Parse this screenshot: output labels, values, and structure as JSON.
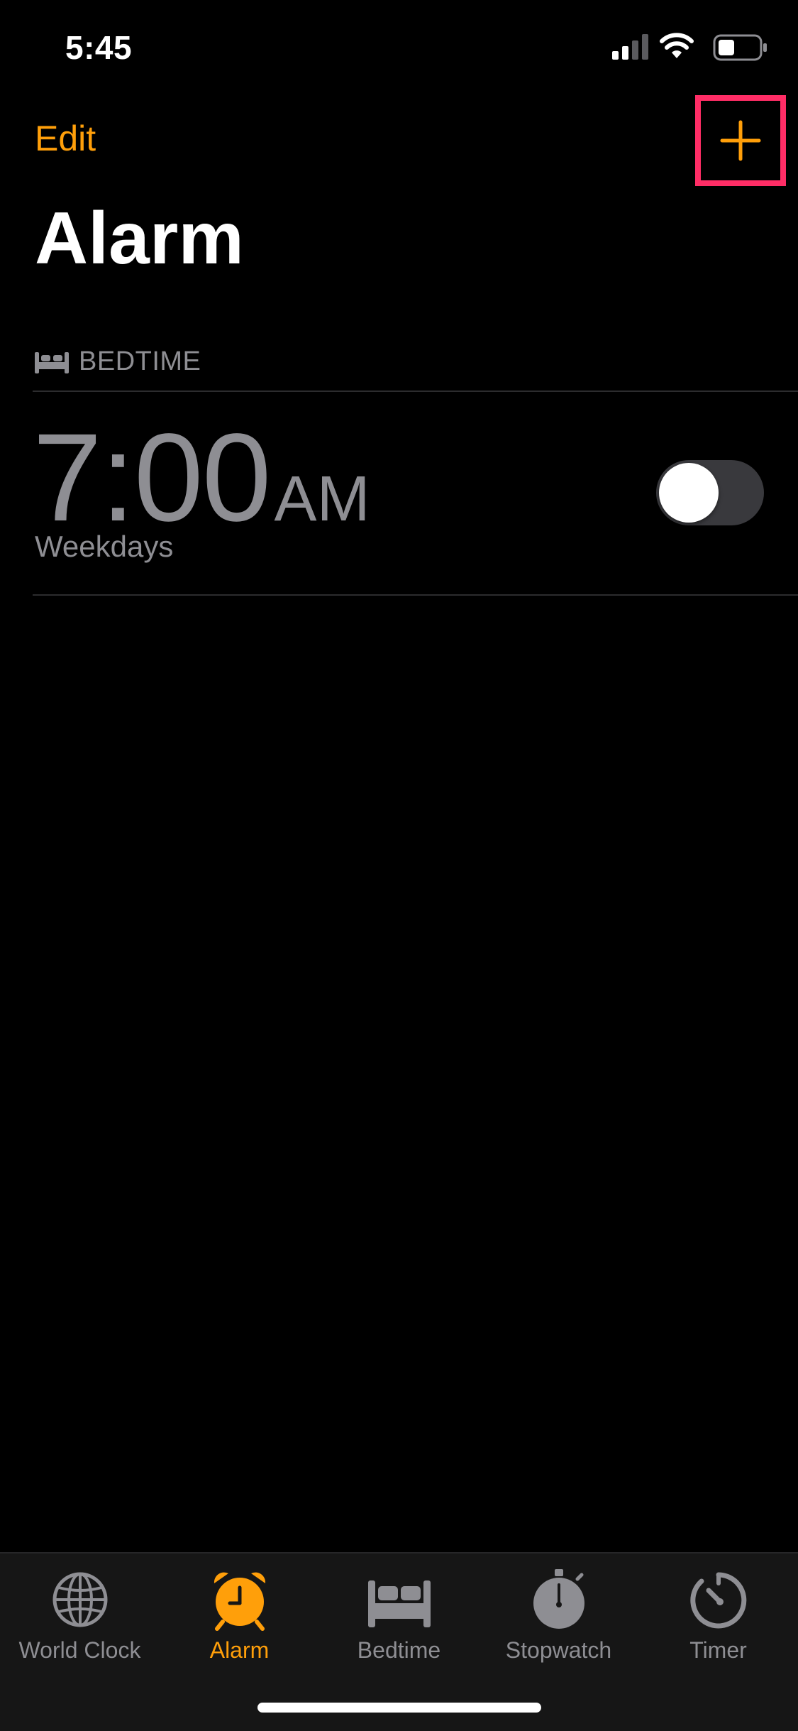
{
  "status_bar": {
    "time": "5:45"
  },
  "nav": {
    "edit_label": "Edit",
    "add_symbol": "+"
  },
  "page": {
    "title": "Alarm"
  },
  "bedtime_section": {
    "header": "BEDTIME",
    "alarm": {
      "time": "7:00",
      "period": "AM",
      "repeat": "Weekdays",
      "enabled": false
    }
  },
  "tab_bar": {
    "tabs": [
      {
        "label": "World Clock",
        "icon": "globe-icon",
        "active": false
      },
      {
        "label": "Alarm",
        "icon": "alarm-clock-icon",
        "active": true
      },
      {
        "label": "Bedtime",
        "icon": "bed-icon",
        "active": false
      },
      {
        "label": "Stopwatch",
        "icon": "stopwatch-icon",
        "active": false
      },
      {
        "label": "Timer",
        "icon": "timer-icon",
        "active": false
      }
    ]
  },
  "colors": {
    "accent": "#ff9f0a",
    "highlight": "#ff2d66",
    "secondary_text": "#8e8e93",
    "background": "#000000"
  }
}
